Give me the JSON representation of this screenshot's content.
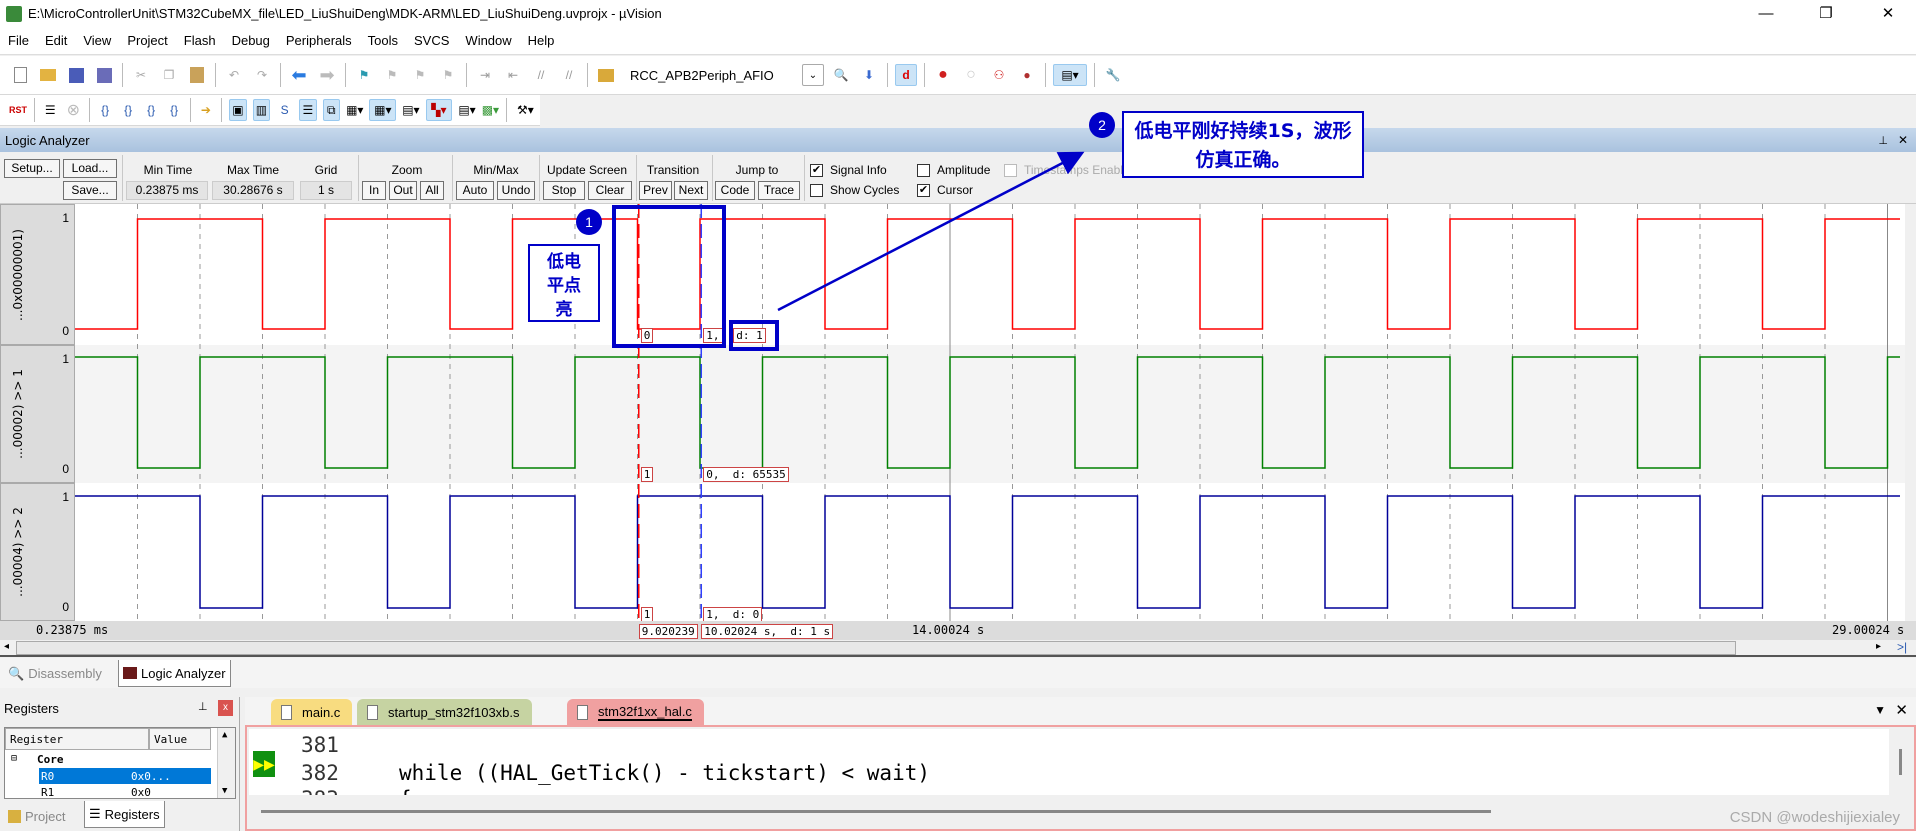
{
  "window": {
    "title": "E:\\MicroControllerUnit\\STM32CubeMX_file\\LED_LiuShuiDeng\\MDK-ARM\\LED_LiuShuiDeng.uvprojx - µVision",
    "minimize": "—",
    "maximize": "❐",
    "close": "✕"
  },
  "menu": [
    "File",
    "Edit",
    "View",
    "Project",
    "Flash",
    "Debug",
    "Peripherals",
    "Tools",
    "SVCS",
    "Window",
    "Help"
  ],
  "toolbar": {
    "find_value": "RCC_APB2Periph_AFIO",
    "rst_label": "RST"
  },
  "logic_analyzer": {
    "title": "Logic Analyzer",
    "pin": "📌",
    "close": "✕",
    "setup": "Setup...",
    "load": "Load...",
    "save": "Save...",
    "min_time_label": "Min Time",
    "min_time": "0.23875 ms",
    "max_time_label": "Max Time",
    "max_time": "30.28676 s",
    "grid_label": "Grid",
    "grid": "1 s",
    "zoom_label": "Zoom",
    "zoom_in": "In",
    "zoom_out": "Out",
    "zoom_all": "All",
    "minmax_label": "Min/Max",
    "auto": "Auto",
    "undo": "Undo",
    "update_label": "Update Screen",
    "stop": "Stop",
    "clear": "Clear",
    "transition_label": "Transition",
    "prev": "Prev",
    "next": "Next",
    "jump_label": "Jump to",
    "code": "Code",
    "trace": "Trace",
    "signal_info": {
      "label": "Signal Info",
      "checked": true
    },
    "amplitude": {
      "label": "Amplitude",
      "checked": false
    },
    "timestamps": {
      "label": "Timestamps Enable",
      "checked": false,
      "disabled": true
    },
    "show_cycles": {
      "label": "Show Cycles",
      "checked": false
    },
    "cursor": {
      "label": "Cursor",
      "checked": true
    }
  },
  "chart_data": {
    "type": "line",
    "x_unit": "s",
    "xlim": [
      0,
      29.2
    ],
    "grid_s": 1,
    "axis_labels": {
      "left": "0.23875 ms",
      "mid": "14.00024 s",
      "right": "29.00024 s"
    },
    "series": [
      {
        "name": "...0x00000001)",
        "color": "#ff0000",
        "high": "1",
        "low": "0",
        "transitions": [
          [
            0,
            0
          ],
          [
            1,
            1
          ],
          [
            3,
            0
          ],
          [
            4,
            1
          ],
          [
            6,
            0
          ],
          [
            7,
            1
          ],
          [
            9,
            0
          ],
          [
            10,
            1
          ],
          [
            12,
            0
          ],
          [
            13,
            1
          ],
          [
            15,
            0
          ],
          [
            16,
            1
          ],
          [
            18,
            0
          ],
          [
            19,
            1
          ],
          [
            21,
            0
          ],
          [
            22,
            1
          ],
          [
            24,
            0
          ],
          [
            25,
            1
          ],
          [
            27,
            0
          ],
          [
            28,
            1
          ]
        ]
      },
      {
        "name": "...00002) >> 1",
        "color": "#008000",
        "high": "1",
        "low": "0",
        "transitions": [
          [
            0,
            1
          ],
          [
            1,
            0
          ],
          [
            2,
            1
          ],
          [
            4,
            0
          ],
          [
            5,
            1
          ],
          [
            7,
            0
          ],
          [
            8,
            1
          ],
          [
            10,
            0
          ],
          [
            11,
            1
          ],
          [
            13,
            0
          ],
          [
            14,
            1
          ],
          [
            16,
            0
          ],
          [
            17,
            1
          ],
          [
            19,
            0
          ],
          [
            20,
            1
          ],
          [
            22,
            0
          ],
          [
            23,
            1
          ],
          [
            25,
            0
          ],
          [
            26,
            1
          ],
          [
            28,
            0
          ],
          [
            29,
            1
          ]
        ]
      },
      {
        "name": "...00004) >> 2",
        "color": "#000099",
        "high": "1",
        "low": "0",
        "transitions": [
          [
            0,
            1
          ],
          [
            2,
            0
          ],
          [
            3,
            1
          ],
          [
            5,
            0
          ],
          [
            6,
            1
          ],
          [
            8,
            0
          ],
          [
            9,
            1
          ],
          [
            11,
            0
          ],
          [
            12,
            1
          ],
          [
            14,
            0
          ],
          [
            15,
            1
          ],
          [
            17,
            0
          ],
          [
            18,
            1
          ],
          [
            20,
            0
          ],
          [
            21,
            1
          ],
          [
            23,
            0
          ],
          [
            24,
            1
          ],
          [
            26,
            0
          ],
          [
            27,
            1
          ]
        ]
      }
    ],
    "cursors": {
      "red_s": 9.020239,
      "blue_s": 10.02024
    },
    "cursor_labels": {
      "row1": {
        "red": "0",
        "blue": "1,",
        "delta": "d: 1"
      },
      "row2": {
        "red": "1",
        "blue": "0,  d: 65535"
      },
      "row3": {
        "red": "1",
        "blue": "1,  d: 0"
      },
      "time": {
        "red": "9.020239",
        "blue": "10.02024 s,  d: 1 s"
      }
    }
  },
  "annotations": {
    "n1": "1",
    "text1": "低电平点亮",
    "n2": "2",
    "text2": "低电平刚好持续1S，波形仿真正确。"
  },
  "bottom_tabs": {
    "disassembly": "Disassembly",
    "logic": "Logic Analyzer"
  },
  "registers": {
    "title": "Registers",
    "col_register": "Register",
    "col_value": "Value",
    "group": "Core",
    "rows": [
      {
        "name": "R0",
        "value": "0x0..."
      },
      {
        "name": "R1",
        "value": "0x0"
      }
    ],
    "tab_project": "Project",
    "tab_registers": "Registers"
  },
  "editor": {
    "tabs": [
      "main.c",
      "startup_stm32f103xb.s",
      "stm32f1xx_hal.c"
    ],
    "lines": [
      {
        "no": "381",
        "text": ""
      },
      {
        "no": "382",
        "text": "while ((HAL_GetTick() - tickstart) < wait)"
      },
      {
        "no": "383",
        "text": "{"
      }
    ]
  },
  "watermark": "CSDN @wodeshijiexialey"
}
